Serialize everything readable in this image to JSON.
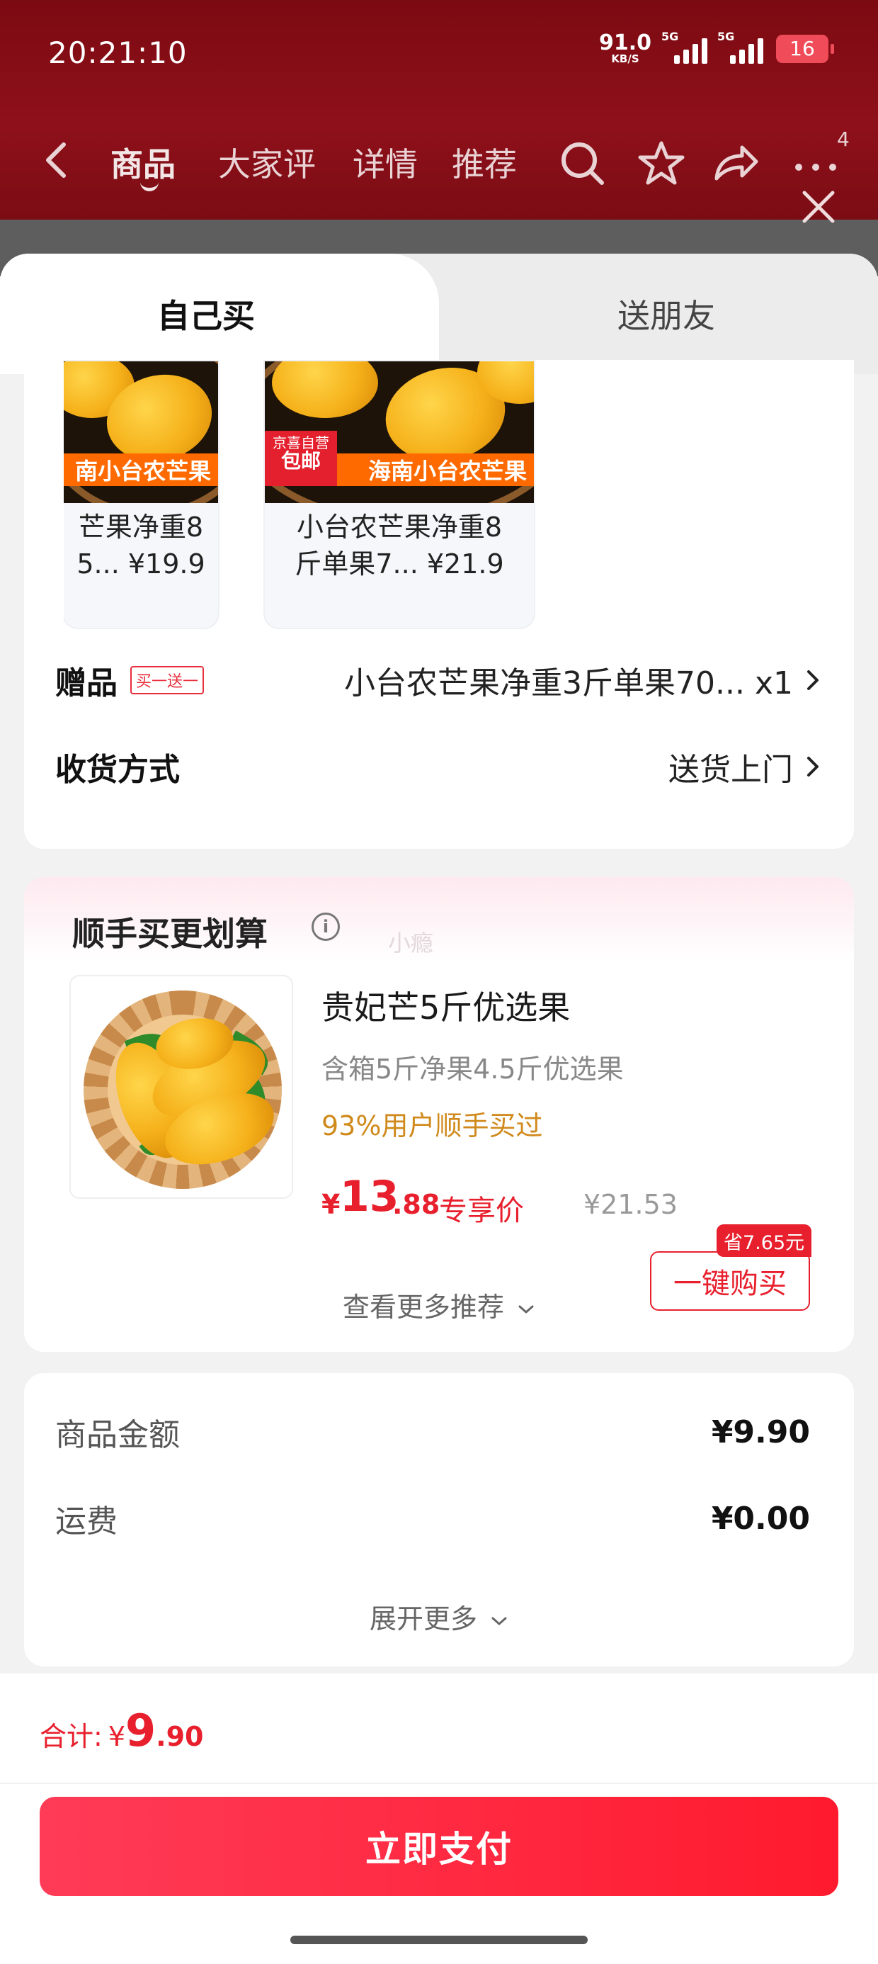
{
  "status_bar": {
    "time": "20:21:10",
    "net_speed": "91.0",
    "net_unit": "KB/S",
    "signal1_label": "5G",
    "signal2_label": "5G",
    "battery": "16"
  },
  "nav": {
    "tabs": [
      "商品",
      "大家评",
      "详情",
      "推荐"
    ],
    "active_tab": "商品",
    "more_badge": "4"
  },
  "sheet": {
    "tabs": {
      "self_buy": "自己买",
      "gift_friend": "送朋友"
    },
    "products": [
      {
        "banner": "南小台农芒果",
        "name_line1": "芒果净重8",
        "name_line2": "5... ¥19.9"
      },
      {
        "tag_line1": "京喜自营",
        "tag_line2": "包邮",
        "banner": "海南小台农芒果",
        "name_line1": "小台农芒果净重8",
        "name_line2": "斤单果7... ¥21.9"
      }
    ],
    "gift": {
      "label": "赠品",
      "badge": "买一送一",
      "value": "小台农芒果净重3斤单果70... x1"
    },
    "delivery": {
      "label": "收货方式",
      "value": "送货上门"
    }
  },
  "upsell": {
    "title": "顺手买更划算",
    "info_icon": "i",
    "watermark": "小瘾",
    "product_name": "贵妃芒5斤优选果",
    "product_sub": "含箱5斤净果4.5斤优选果",
    "social_proof": "93%用户顺手买过",
    "price_yen": "¥",
    "price_int": "13",
    "price_dec": ".88",
    "price_label": "专享价",
    "original_price": "¥21.53",
    "save_badge": "省7.65元",
    "buy_button": "一键购买",
    "more_link": "查看更多推荐"
  },
  "amounts": {
    "rows": [
      {
        "label": "商品金额",
        "value": "¥9.90"
      },
      {
        "label": "运费",
        "value": "¥0.00"
      }
    ],
    "expand": "展开更多"
  },
  "footer": {
    "total_label": "合计:",
    "total_yen": "¥",
    "total_int": "9",
    "total_dec": ".90",
    "pay_button": "立即支付"
  },
  "colors": {
    "accent_red": "#e8202e",
    "header_dim": "#7c0a12",
    "social_orange": "#d08a1c",
    "pay_gradient_start": "#ff3b57",
    "pay_gradient_end": "#ff1a2e"
  }
}
